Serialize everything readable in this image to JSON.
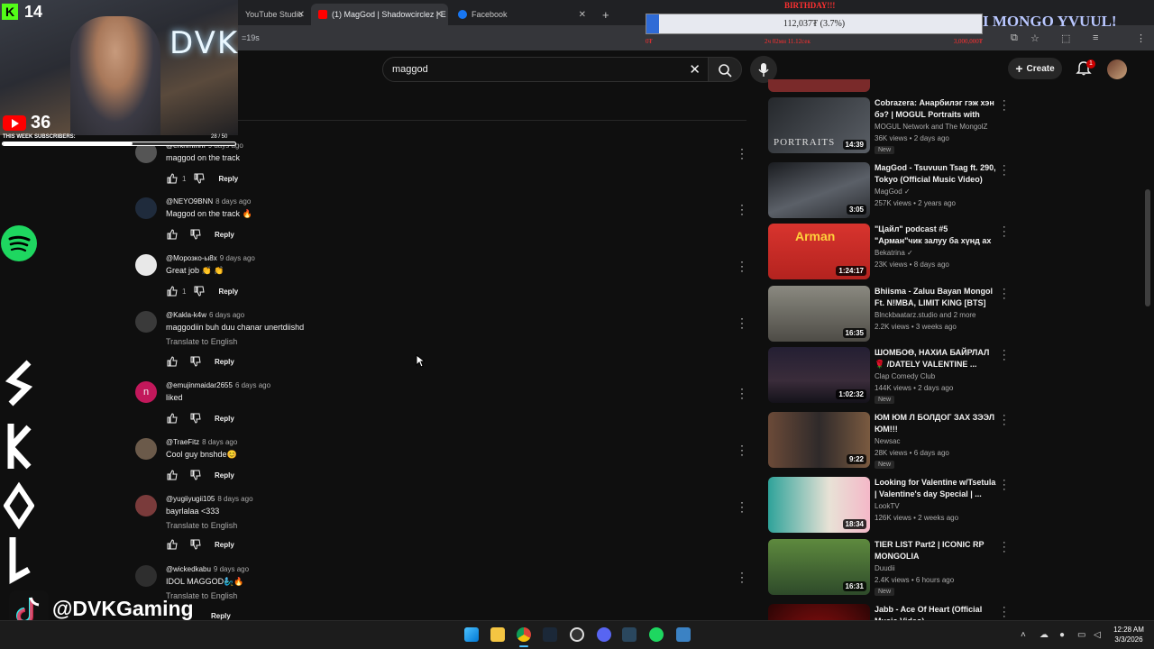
{
  "browser": {
    "tabs": [
      {
        "label": "YouTube Studio",
        "active": false
      },
      {
        "label": "(1) MagGod | Shadowcirclez | E",
        "active": true
      },
      {
        "label": "Facebook",
        "active": false
      }
    ],
    "new_tab": "+",
    "url": "=19s"
  },
  "youtube": {
    "search_value": "maggod",
    "create_label": "Create",
    "notification_count": "1"
  },
  "comments": [
    {
      "author": "@erkhmmm",
      "age": "9 days ago",
      "text": "maggod on the track",
      "likes": "1",
      "translate": ""
    },
    {
      "author": "@NEYO9BNN",
      "age": "8 days ago",
      "text": "Maggod on the track 🔥",
      "likes": "",
      "translate": ""
    },
    {
      "author": "@Морозко-ы8х",
      "age": "9 days ago",
      "text": "Great job 👏 👏",
      "likes": "1",
      "translate": ""
    },
    {
      "author": "@Kakla-k4w",
      "age": "6 days ago",
      "text": "maggodiin buh duu chanar unertdiishd",
      "likes": "",
      "translate": "Translate to English"
    },
    {
      "author": "@emujinmaidar2655",
      "age": "6 days ago",
      "text": "liked",
      "likes": "",
      "translate": "",
      "initial": "n"
    },
    {
      "author": "@TraeFitz",
      "age": "8 days ago",
      "text": "Cool guy bnshde😊",
      "likes": "",
      "translate": ""
    },
    {
      "author": "@yugiiyugii105",
      "age": "8 days ago",
      "text": "bayrlalaa <333",
      "likes": "",
      "translate": "Translate to English"
    },
    {
      "author": "@wickedkabu",
      "age": "9 days ago",
      "text": "IDOL MAGGOD🧞‍♂️🔥",
      "likes": "",
      "translate": "Translate to English"
    }
  ],
  "reply_label": "Reply",
  "recommendations": [
    {
      "title": "Cobrazera: Анарбилэг гэж хэн бэ? | MOGUL Portraits with Th...",
      "channel": "MOGUL Network and The MongolZ",
      "meta": "36K views • 2 days ago",
      "badge": "New",
      "duration": "14:39",
      "color": "#3b4046"
    },
    {
      "title": "MagGod - Tsuvuun Tsag ft. 290, Tokyo (Official Music Video)",
      "channel": "MagGod ✓",
      "meta": "257K views • 2 years ago",
      "badge": "",
      "duration": "3:05",
      "color": "#4a4e55"
    },
    {
      "title": "\"Цайл\" podcast #5 \"Арман\"чик залуу ба хүнд ах нар",
      "channel": "Bekatrina ✓",
      "meta": "23K views • 8 days ago",
      "badge": "",
      "duration": "1:24:17",
      "color": "#c8332e"
    },
    {
      "title": "Bhiisma - Zaluu Bayan Mongol Ft. N!MBA, LIMIT KING [BTS]",
      "channel": "Blnckbaatarz.studio and 2 more",
      "meta": "2.2K views • 3 weeks ago",
      "badge": "",
      "duration": "16:35",
      "color": "#6d6b63"
    },
    {
      "title": "ШОМБОӨ, НАХИА БАЙРЛАЛ 🌹 /DATELY VALENTINE ...",
      "channel": "Clap Comedy Club",
      "meta": "144K views • 2 days ago",
      "badge": "New",
      "duration": "1:02:32",
      "color": "#2d2a3e"
    },
    {
      "title": "ЮМ ЮМ Л БОЛДОГ ЗАХ ЗЭЭЛ ЮМ!!!",
      "channel": "Newsac",
      "meta": "28K views • 6 days ago",
      "badge": "New",
      "duration": "9:22",
      "color": "#5b4436"
    },
    {
      "title": "Looking for Valentine w/Tsetula | Valentine's day Special | ...",
      "channel": "LookTV",
      "meta": "126K views • 2 weeks ago",
      "badge": "",
      "duration": "18:34",
      "color": "#2f8f86"
    },
    {
      "title": "TIER LIST Part2 | ICONIC RP MONGOLIA",
      "channel": "Duudii",
      "meta": "2.4K views • 6 hours ago",
      "badge": "New",
      "duration": "16:31",
      "color": "#4b7a3a"
    },
    {
      "title": "Jabb - Ace Of Heart (Official Music Video)",
      "channel": "",
      "meta": "",
      "badge": "",
      "duration": "",
      "color": "#3a0808"
    }
  ],
  "overlay": {
    "kick_count": "14",
    "youtube_count": "36",
    "subs_label": "THIS WEEK SUBSCRIBERS:",
    "subs_progress": "28 / 50",
    "subs_fraction": 0.56,
    "neon_text": "DVK",
    "goal_title": "BIRTHDAY!!!",
    "goal_text": "112,037₮ (3.7%)",
    "goal_fraction": 0.037,
    "goal_start": "0₮",
    "goal_ends": "2ч 02мн 11.12сек",
    "goal_target": "3,000,000₮",
    "marquee": "I MONGO YVUUL!",
    "tiktok_handle": "@DVKGaming"
  },
  "taskbar": {
    "time": "12:28 AM",
    "date": "3/3/2026"
  }
}
